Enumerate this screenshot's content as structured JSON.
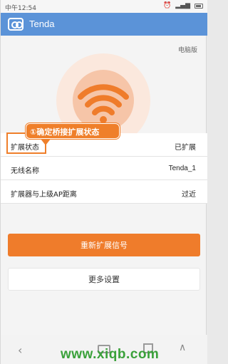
{
  "status_bar": {
    "time": "中午12:54",
    "icons": [
      "phone-icon",
      "clock-icon",
      "alarm-icon",
      "signal-icon",
      "battery-icon"
    ]
  },
  "app_bar": {
    "title": "Tenda",
    "logo_icon": "tenda-logo-icon",
    "background": "#5b93d8"
  },
  "desktop_link": "电脑版",
  "hero": {
    "icon": "wifi-icon",
    "accent": "#ef7c2b"
  },
  "callout": {
    "text": "①确定桥接扩展状态",
    "color": "#ef7f2a"
  },
  "status_rows": [
    {
      "label": "扩展状态",
      "value": "已扩展"
    },
    {
      "label": "无线名称",
      "value": "Tenda_1"
    },
    {
      "label": "扩展器与上级AP距离",
      "value": "过近"
    }
  ],
  "buttons": {
    "reextend": "重新扩展信号",
    "more_settings": "更多设置"
  },
  "nav": {
    "icons": [
      "back-icon",
      "home-icon",
      "recent-apps-icon",
      "up-icon"
    ],
    "back_glyph": "‹",
    "up_glyph": "∧"
  },
  "watermark": "www.xiqb.com"
}
